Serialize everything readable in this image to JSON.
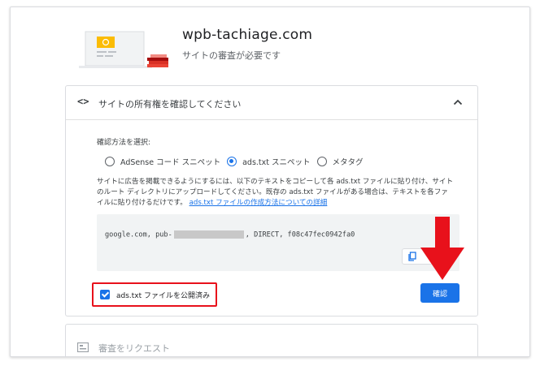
{
  "header": {
    "site_name": "wpb-tachiage.com",
    "subtitle": "サイトの審査が必要です"
  },
  "ownership_section": {
    "title": "サイトの所有権を確認してください",
    "code_icon": "code-brackets-icon",
    "collapse_icon": "chevron-up-icon",
    "method_label": "確認方法を選択:",
    "options": [
      {
        "label": "AdSense コード スニペット",
        "selected": false
      },
      {
        "label": "ads.txt スニペット",
        "selected": true
      },
      {
        "label": "メタタグ",
        "selected": false
      }
    ],
    "description": "サイトに広告を掲載できるようにするには、以下のテキストをコピーして各 ads.txt ファイルに貼り付け、サイトのルート ディレクトリにアップロードしてください。既存の ads.txt ファイルがある場合は、テキストを各ファイルに貼り付けるだけです。",
    "help_link": "ads.txt ファイルの作成方法についての詳細",
    "code_prefix": "google.com, pub-",
    "code_suffix": ", DIRECT, f08c47fec0942fa0",
    "copy_icon": "copy-icon",
    "checkbox_label": "ads.txt ファイルを公開済み",
    "checkbox_checked": true,
    "confirm_label": "確認"
  },
  "request_section": {
    "label": "審査をリクエスト",
    "icon": "review-request-icon"
  },
  "colors": {
    "accent": "#1a73e8",
    "annotation": "#e8111b",
    "code_bg": "#f1f3f4"
  }
}
